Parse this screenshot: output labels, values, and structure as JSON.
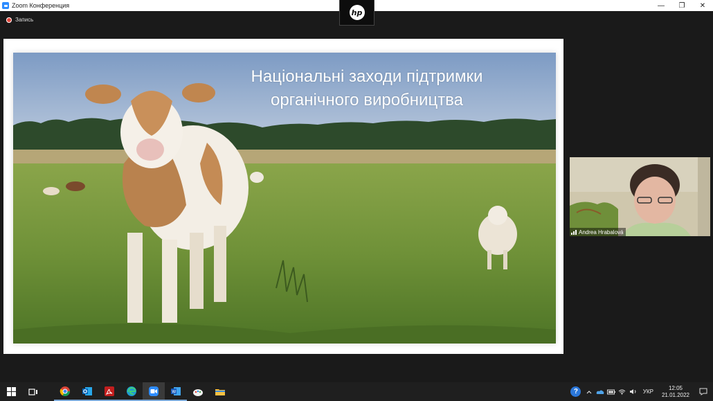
{
  "window": {
    "title": "Zoom Конференция",
    "controls": {
      "minimize": "—",
      "restore": "❐",
      "close": "✕"
    }
  },
  "overlay_tab": {
    "logo_text": "hp"
  },
  "recording": {
    "label": "Запись"
  },
  "slide": {
    "title_line1": "Національні заходи підтримки",
    "title_line2": "органічного виробництва"
  },
  "participant": {
    "name": "Andrea Hrabalová"
  },
  "taskbar": {
    "apps": [
      "windows-start",
      "task-view",
      "chrome",
      "outlook",
      "acrobat",
      "edge",
      "zoom",
      "word",
      "paint",
      "file-explorer"
    ],
    "tray": {
      "help_glyph": "?",
      "language": "УКР",
      "time": "12:05",
      "date": "21.01.2022"
    }
  },
  "colors": {
    "zoom_blue": "#2d8cff",
    "record_red": "#e5483d",
    "taskbar": "#1f1f1f"
  }
}
